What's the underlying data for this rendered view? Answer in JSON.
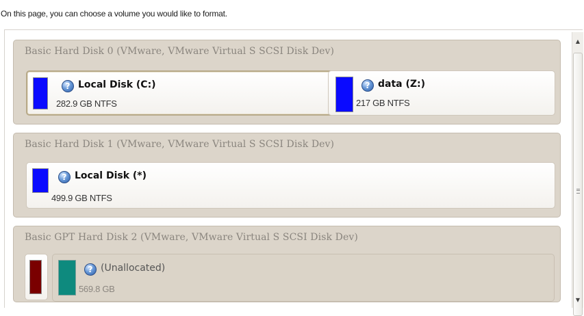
{
  "intro_text": "On this page, you can choose a volume you would like to format.",
  "colors": {
    "group_bg": "#dcd5ca",
    "fill_blue": "#0a0aff",
    "fill_darkred": "#7a0000",
    "fill_teal": "#0e8a7e"
  },
  "disks": [
    {
      "header": "Basic Hard Disk 0 (VMware, VMware Virtual S SCSI Disk Dev)",
      "volumes": [
        {
          "icon": "question-mark-icon",
          "name": "Local Disk (C:)",
          "size": "282.9 GB NTFS",
          "selected": true
        },
        {
          "icon": "question-mark-icon",
          "name": "data (Z:)",
          "size": "217 GB NTFS",
          "selected": false
        }
      ]
    },
    {
      "header": "Basic Hard Disk 1 (VMware, VMware Virtual S SCSI Disk Dev)",
      "volumes": [
        {
          "icon": "question-mark-icon",
          "name": "Local Disk (*)",
          "size": "499.9 GB NTFS",
          "selected": false
        }
      ]
    },
    {
      "header": "Basic GPT Hard Disk 2 (VMware, VMware Virtual S SCSI Disk Dev)",
      "volumes": [
        {
          "icon": "partition-color-bar",
          "name": "",
          "size": "",
          "selected": false
        },
        {
          "icon": "question-mark-icon",
          "name": "(Unallocated)",
          "size": "569.8 GB",
          "selected": false
        }
      ]
    }
  ],
  "icon_glyph": "?"
}
